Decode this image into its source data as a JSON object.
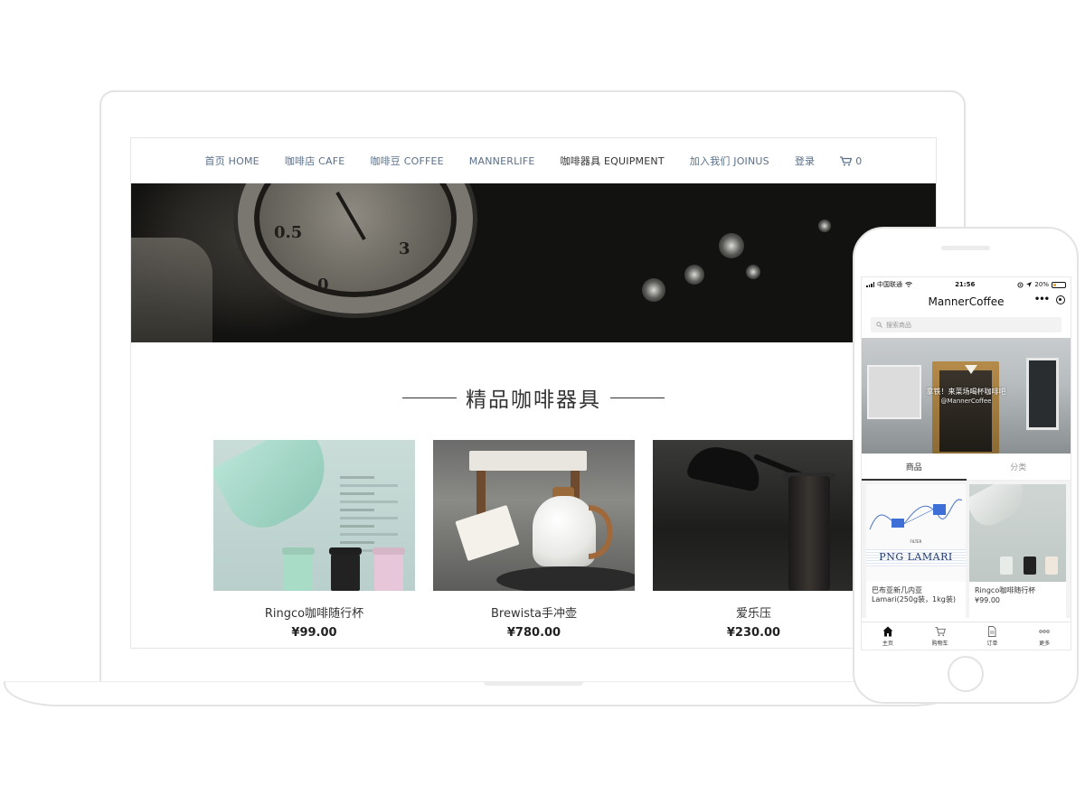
{
  "site": {
    "nav": [
      {
        "label": "首页 HOME"
      },
      {
        "label": "咖啡店 CAFE"
      },
      {
        "label": "咖啡豆 COFFEE"
      },
      {
        "label": "MANNERLIFE"
      },
      {
        "label": "咖啡器具 EQUIPMENT",
        "active": true
      },
      {
        "label": "加入我们 JOINUS"
      },
      {
        "label": "登录"
      }
    ],
    "cart_count": "0",
    "hero_gauge": {
      "n1": "0.5",
      "n2": "3",
      "n3": "0"
    },
    "section_title": "精品咖啡器具",
    "products": [
      {
        "name": "Ringco咖啡随行杯",
        "price": "¥99.00"
      },
      {
        "name": "Brewista手冲壶",
        "price": "¥780.00"
      },
      {
        "name": "爱乐压",
        "price": "¥230.00"
      }
    ]
  },
  "phone": {
    "status": {
      "carrier": "中国联通",
      "time": "21:56",
      "battery": "20%"
    },
    "title": "MannerCoffee",
    "search_placeholder": "搜索商品",
    "banner": {
      "line1": "拿铁！来菜场喝杯咖啡吧",
      "line2": "@MannerCoffee"
    },
    "tabs": [
      {
        "label": "商品",
        "active": true
      },
      {
        "label": "分类"
      }
    ],
    "products": [
      {
        "name": "巴布亚新几内亚Lamari(250g装，1kg装)",
        "price": "",
        "image_text": "PNG LAMARI",
        "image_subtext": "FILTER"
      },
      {
        "name": "Ringco咖啡随行杯",
        "price": "¥99.00"
      }
    ],
    "tabbar": [
      {
        "label": "主页",
        "icon": "home-icon"
      },
      {
        "label": "购物车",
        "icon": "cart-icon"
      },
      {
        "label": "订单",
        "icon": "order-icon"
      },
      {
        "label": "更多",
        "icon": "more-icon"
      }
    ]
  },
  "colors": {
    "nav_text": "#59708a",
    "accent_dark": "#333333"
  }
}
